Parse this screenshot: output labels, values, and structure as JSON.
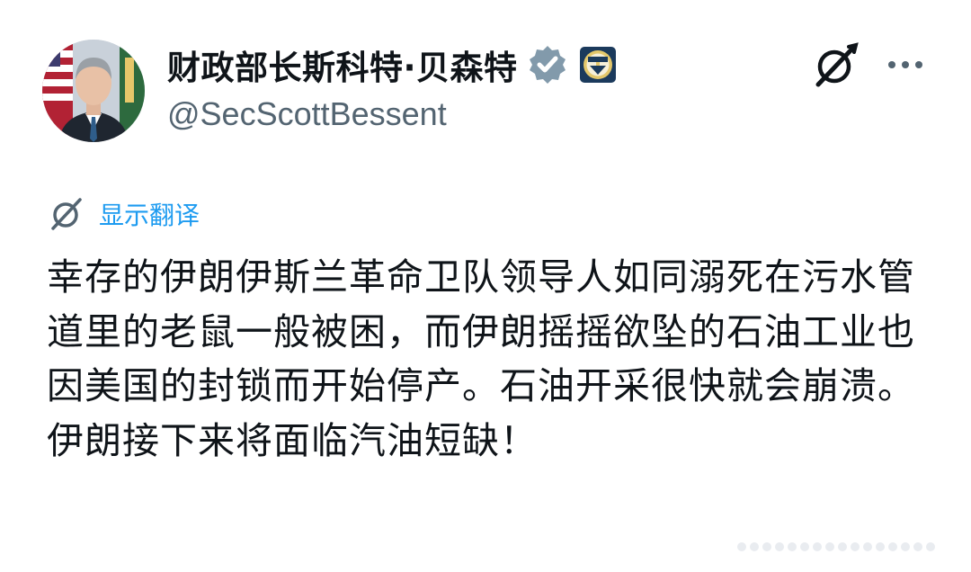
{
  "profile": {
    "display_name": "财政部长斯科特·贝森特",
    "handle": "@SecScottBessent",
    "avatar_icon": "avatar-photo",
    "verified_icon": "verified-badge-icon",
    "verified_color": "#829aab",
    "affiliation_icon": "treasury-seal-icon"
  },
  "actions": {
    "grok_icon": "grok-icon",
    "more_icon": "more-dots-icon"
  },
  "translate": {
    "label": "显示翻译",
    "icon": "grok-icon",
    "color": "#1d9bf0"
  },
  "tweet": {
    "text": "幸存的伊朗伊斯兰革命卫队领导人如同溺死在污水管道里的老鼠一般被困，而伊朗摇摇欲坠的石油工业也因美国的封锁而开始停产。石油开采很快就会崩溃。伊朗接下来将面临汽油短缺！"
  }
}
